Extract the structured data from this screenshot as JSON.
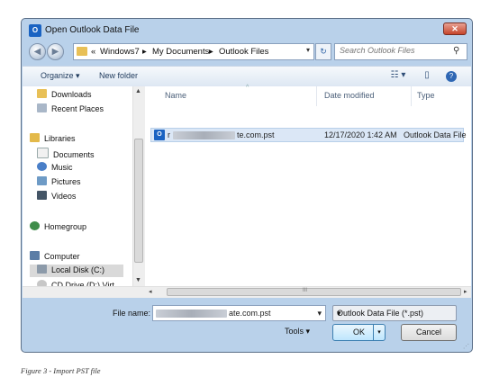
{
  "window": {
    "title": "Open Outlook Data File",
    "app_icon": "O",
    "close_glyph": "✕"
  },
  "address": {
    "overflow": "«",
    "crumbs": [
      "Windows7",
      "My Documents",
      "Outlook Files"
    ],
    "separator": "▸",
    "dropdown": "▾",
    "refresh_glyph": "↻"
  },
  "search": {
    "placeholder": "Search Outlook Files",
    "icon": "⚲"
  },
  "toolbar": {
    "organize": "Organize ▾",
    "new_folder": "New folder",
    "views_glyph": "☷ ▾",
    "pane_glyph": "▯",
    "help_glyph": "?"
  },
  "nav": {
    "items": [
      {
        "label": "Downloads",
        "icon": "downloads-icon"
      },
      {
        "label": "Recent Places",
        "icon": "recent-places-icon"
      },
      {
        "label": "Libraries",
        "icon": "libraries-icon"
      },
      {
        "label": "Documents",
        "icon": "documents-icon"
      },
      {
        "label": "Music",
        "icon": "music-icon"
      },
      {
        "label": "Pictures",
        "icon": "pictures-icon"
      },
      {
        "label": "Videos",
        "icon": "videos-icon"
      },
      {
        "label": "Homegroup",
        "icon": "homegroup-icon"
      },
      {
        "label": "Computer",
        "icon": "computer-icon"
      },
      {
        "label": "Local Disk (C:)",
        "icon": "disk-icon"
      },
      {
        "label": "CD Drive (D:) Virt",
        "icon": "cd-drive-icon"
      }
    ]
  },
  "columns": {
    "name": "Name",
    "date": "Date modified",
    "type": "Type",
    "sort_glyph": "^"
  },
  "files": [
    {
      "name_start": "r",
      "name_end": "te.com.pst",
      "date": "12/17/2020 1:42 AM",
      "type": "Outlook Data File"
    }
  ],
  "scroll_arrows": {
    "up": "▲",
    "down": "▼",
    "left": "◂",
    "right": "▸",
    "grip": "III"
  },
  "bottom": {
    "file_name_label": "File name:",
    "file_name_end": "ate.com.pst",
    "filter": "Outlook Data File (*.pst)",
    "tools": "Tools ▾",
    "ok": "OK",
    "cancel": "Cancel",
    "resize_glyph": "⋰"
  },
  "caption": "Figure 3 - Import PST file",
  "colors": {
    "accent": "#1a63c2",
    "selection": "#dbe7f6",
    "frame": "#b9d1ea"
  }
}
